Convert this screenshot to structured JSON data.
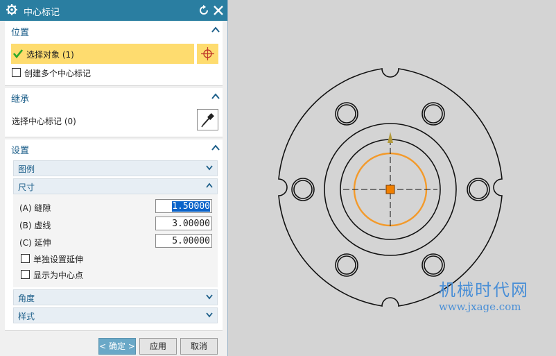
{
  "dialog": {
    "title": "中心标记",
    "icons": {
      "gear": "gear-icon",
      "reset": "reset-icon",
      "close": "close-icon"
    }
  },
  "position": {
    "header": "位置",
    "select_object": "选择对象 (1)",
    "create_multiple": "创建多个中心标记",
    "create_multiple_checked": false
  },
  "inherit": {
    "header": "继承",
    "select_center_mark": "选择中心标记 (0)"
  },
  "settings": {
    "header": "设置",
    "legend": "图例",
    "size": "尺寸",
    "gap_label": "(A) 缝隙",
    "gap_value": "1.50000",
    "dash_label": "(B) 虚线",
    "dash_value": "3.00000",
    "extend_label": "(C) 延伸",
    "extend_value": "5.00000",
    "separate_extend": "单独设置延伸",
    "separate_extend_checked": false,
    "show_center_point": "显示为中心点",
    "show_center_point_checked": false,
    "angle": "角度",
    "style": "样式"
  },
  "buttons": {
    "ok": "< 确定 >",
    "apply": "应用",
    "cancel": "取消"
  },
  "watermark": {
    "line1": "机械时代网",
    "line2": "www.jxage.com"
  },
  "colors": {
    "titlebar": "#2a7ea1",
    "selection": "#fedc6f",
    "highlight_circle": "#f39a2b",
    "watermark": "#4a8fd6"
  }
}
